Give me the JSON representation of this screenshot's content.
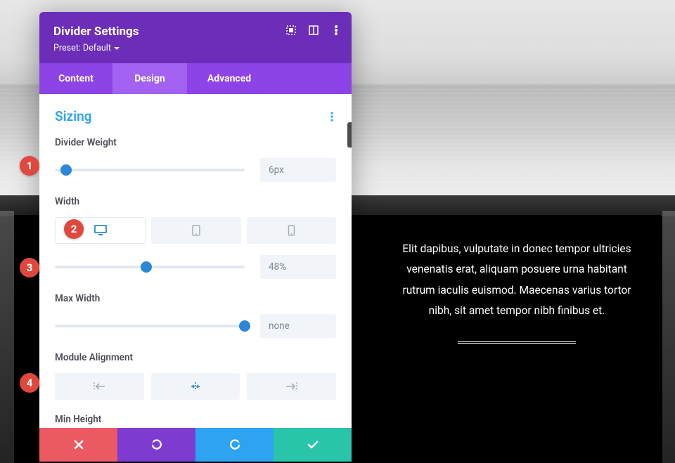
{
  "panel": {
    "title": "Divider Settings",
    "preset_label": "Preset: Default",
    "tabs": {
      "content": "Content",
      "design": "Design",
      "advanced": "Advanced",
      "active": "Design"
    },
    "section": {
      "title": "Sizing"
    },
    "fields": {
      "divider_weight": {
        "label": "Divider Weight",
        "value": "6px",
        "slider_pct": 6
      },
      "width": {
        "label": "Width",
        "value": "48%",
        "slider_pct": 48,
        "device": "desktop"
      },
      "max_width": {
        "label": "Max Width",
        "value": "none",
        "slider_pct": 100
      },
      "module_alignment": {
        "label": "Module Alignment",
        "value": "center"
      },
      "min_height": {
        "label": "Min Height"
      }
    },
    "footer_actions": [
      "cancel",
      "undo",
      "redo",
      "save"
    ]
  },
  "callouts": [
    "1",
    "2",
    "3",
    "4"
  ],
  "preview": {
    "text": "Elit dapibus, vulputate in donec tempor ultricies venenatis erat, aliquam posuere urna habitant rutrum iaculis euismod. Maecenas varius tortor nibh, sit amet tempor nibh finibus et."
  },
  "colors": {
    "accent_purple": "#6c2eb9",
    "accent_blue": "#2b87da",
    "success": "#29c4a9",
    "danger": "#eb5a63"
  }
}
